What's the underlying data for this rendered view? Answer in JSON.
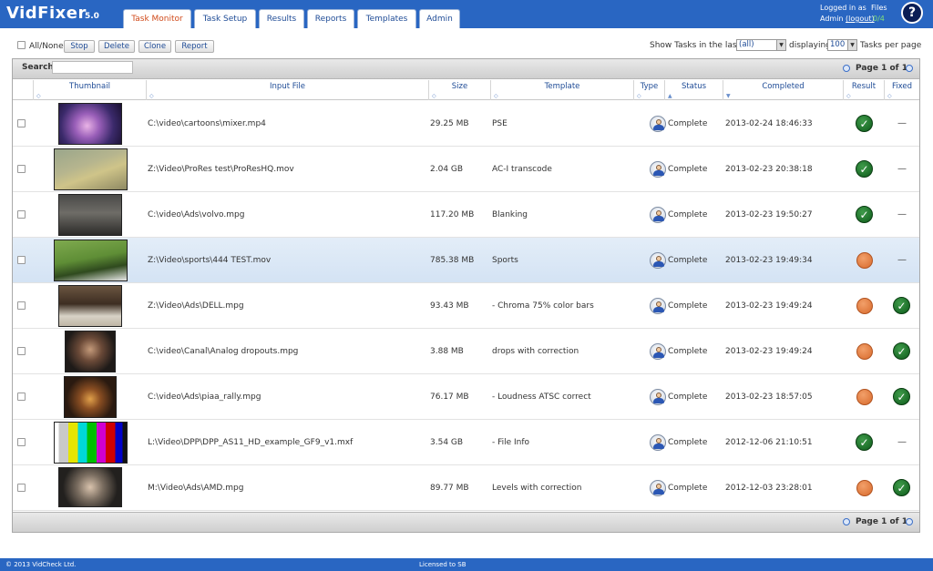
{
  "app": {
    "name": "VidFixer",
    "version": "5.0"
  },
  "tabs": [
    {
      "label": "Task Monitor",
      "active": true
    },
    {
      "label": "Task Setup"
    },
    {
      "label": "Results"
    },
    {
      "label": "Reports"
    },
    {
      "label": "Templates"
    },
    {
      "label": "Admin"
    }
  ],
  "user": {
    "logged_in_as": "Logged in as",
    "name": "Admin",
    "logout": "(logout)",
    "files_label": "Files",
    "files_count": "0/4"
  },
  "help_icon": "?",
  "toolbar": {
    "all_none": "All/None",
    "buttons": [
      "Stop",
      "Delete",
      "Clone",
      "Report"
    ],
    "show_tasks_label": "Show Tasks in the last",
    "period_value": "(all)",
    "displaying_label": "displaying",
    "per_page_value": "100",
    "tasks_per_page_label": "Tasks per page"
  },
  "search": {
    "label": "Search",
    "value": ""
  },
  "pagination": {
    "text": "Page 1 of 1"
  },
  "columns": [
    "Thumbnail",
    "Input File",
    "Size",
    "Template",
    "Type",
    "Status",
    "Completed",
    "Result",
    "Fixed"
  ],
  "rows": [
    {
      "file": "C:\\video\\cartoons\\mixer.mp4",
      "size": "29.25 MB",
      "template": "PSE",
      "status": "Complete",
      "completed": "2013-02-24 18:46:33",
      "result": "pass",
      "fixed": "—",
      "selected": false
    },
    {
      "file": "Z:\\Video\\ProRes test\\ProResHQ.mov",
      "size": "2.04 GB",
      "template": "AC-I transcode",
      "status": "Complete",
      "completed": "2013-02-23 20:38:18",
      "result": "pass",
      "fixed": "—",
      "selected": false
    },
    {
      "file": "C:\\video\\Ads\\volvo.mpg",
      "size": "117.20 MB",
      "template": "Blanking",
      "status": "Complete",
      "completed": "2013-02-23 19:50:27",
      "result": "pass",
      "fixed": "—",
      "selected": false
    },
    {
      "file": "Z:\\Video\\sports\\444 TEST.mov",
      "size": "785.38 MB",
      "template": "Sports",
      "status": "Complete",
      "completed": "2013-02-23 19:49:34",
      "result": "warn",
      "fixed": "—",
      "selected": true
    },
    {
      "file": "Z:\\Video\\Ads\\DELL.mpg",
      "size": "93.43 MB",
      "template": "- Chroma 75% color bars",
      "status": "Complete",
      "completed": "2013-02-23 19:49:24",
      "result": "warn",
      "fixed": "check",
      "selected": false
    },
    {
      "file": "C:\\video\\Canal\\Analog dropouts.mpg",
      "size": "3.88 MB",
      "template": "drops with correction",
      "status": "Complete",
      "completed": "2013-02-23 19:49:24",
      "result": "warn",
      "fixed": "check",
      "selected": false
    },
    {
      "file": "C:\\video\\Ads\\piaa_rally.mpg",
      "size": "76.17 MB",
      "template": "- Loudness ATSC correct",
      "status": "Complete",
      "completed": "2013-02-23 18:57:05",
      "result": "warn",
      "fixed": "check",
      "selected": false
    },
    {
      "file": "L:\\Video\\DPP\\DPP_AS11_HD_example_GF9_v1.mxf",
      "size": "3.54 GB",
      "template": "- File Info",
      "status": "Complete",
      "completed": "2012-12-06 21:10:51",
      "result": "pass",
      "fixed": "—",
      "selected": false
    },
    {
      "file": "M:\\Video\\Ads\\AMD.mpg",
      "size": "89.77 MB",
      "template": "Levels with correction",
      "status": "Complete",
      "completed": "2012-12-03 23:28:01",
      "result": "warn",
      "fixed": "check",
      "selected": false
    }
  ],
  "footer": {
    "copyright": "© 2013 VidCheck Ltd.",
    "license": "Licensed to SB"
  }
}
